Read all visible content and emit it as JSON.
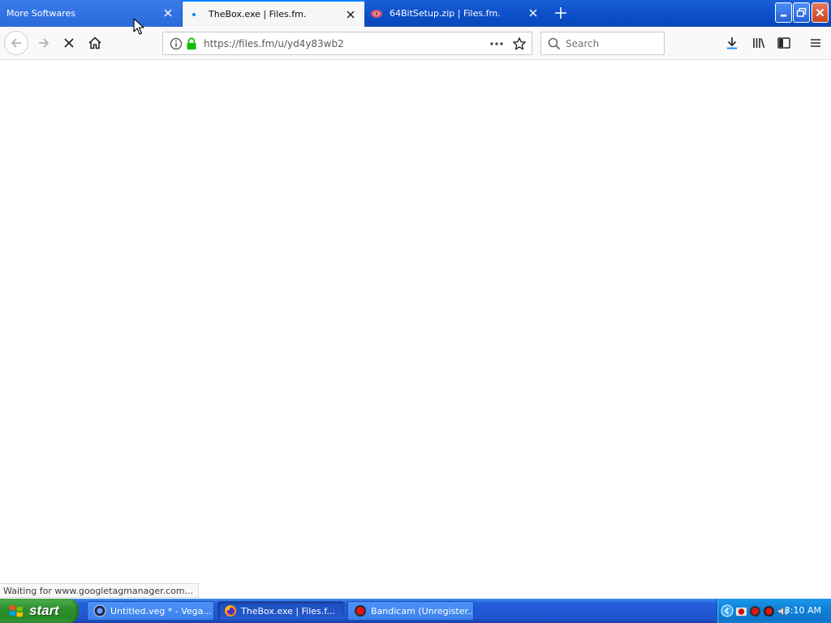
{
  "browser": {
    "tabs": [
      {
        "title": "More Softwares",
        "state": "inactive"
      },
      {
        "title": "TheBox.exe | Files.fm.",
        "state": "active, loading"
      },
      {
        "title": "64BitSetup.zip | Files.fm.",
        "state": "inactive"
      }
    ],
    "urlbar": {
      "url": "https://files.fm/u/yd4y83wb2"
    },
    "searchbar": {
      "placeholder": "Search"
    },
    "status_text": "Waiting for www.googletagmanager.com...",
    "colors": {
      "tabstrip": "#0b4ec8",
      "toolbar": "#f9f9fa",
      "accent": "#0a84ff",
      "lock": "#12bc00"
    }
  },
  "taskbar": {
    "start_label": "start",
    "items": [
      {
        "label": "Untitled.veg * - Vega...",
        "icon": "vegas-icon"
      },
      {
        "label": "TheBox.exe | Files.f...",
        "icon": "firefox-icon"
      },
      {
        "label": "Bandicam (Unregister...",
        "icon": "bandicam-icon"
      }
    ],
    "clock": "3:10 AM"
  }
}
